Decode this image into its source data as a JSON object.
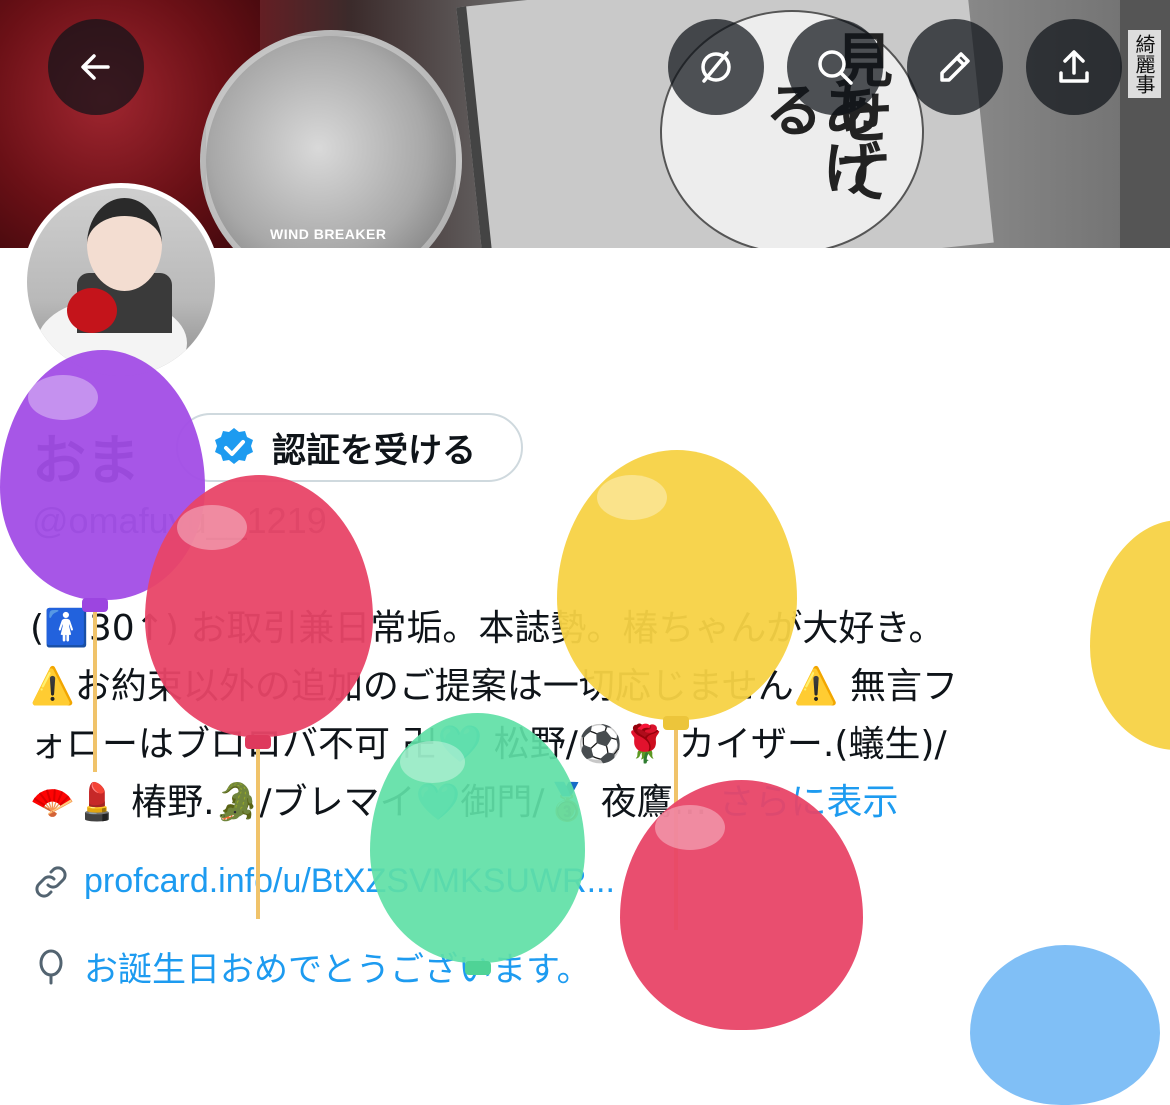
{
  "banner": {
    "badge_text": "WIND BREAKER",
    "manga_text_col1": "見せて",
    "manga_text_col2": "あげる",
    "spine_text": "綺麗事"
  },
  "toolbar": {
    "back_icon": "arrow-left-icon",
    "grok_icon": "grok-icon",
    "search_icon": "search-icon",
    "edit_icon": "pencil-icon",
    "share_icon": "share-icon"
  },
  "profile": {
    "display_name": "おま",
    "verify_label": "認証を受ける",
    "handle": "@omafuyu__1219",
    "bio_lines": [
      "(🚺30↑) お取引兼日常垢。本誌勢。椿ちゃんが大好き。",
      "⚠️お約束以外の追加のご提案は一切応じません⚠️ 無言フ",
      "ォローはブロロバ不可 卍🩵 松野/⚽️🌹 カイザー.(蟻生)/",
      "🪭💄 椿野.🐊/ブレマイ🩵御門/🥉 夜鷹..."
    ],
    "show_more": "さらに表示",
    "link_text": "profcard.info/u/BtXZSVMKSUWR...",
    "birthday_text": "お誕生日おめでとうございます。"
  },
  "colors": {
    "accent": "#1d9bf0",
    "secondary_text": "#536471",
    "balloon_purple": "#a24de6",
    "balloon_red": "#e84467",
    "balloon_yellow": "#f7d245",
    "balloon_green": "#5fe0a6",
    "balloon_blue": "#79bcf5"
  }
}
